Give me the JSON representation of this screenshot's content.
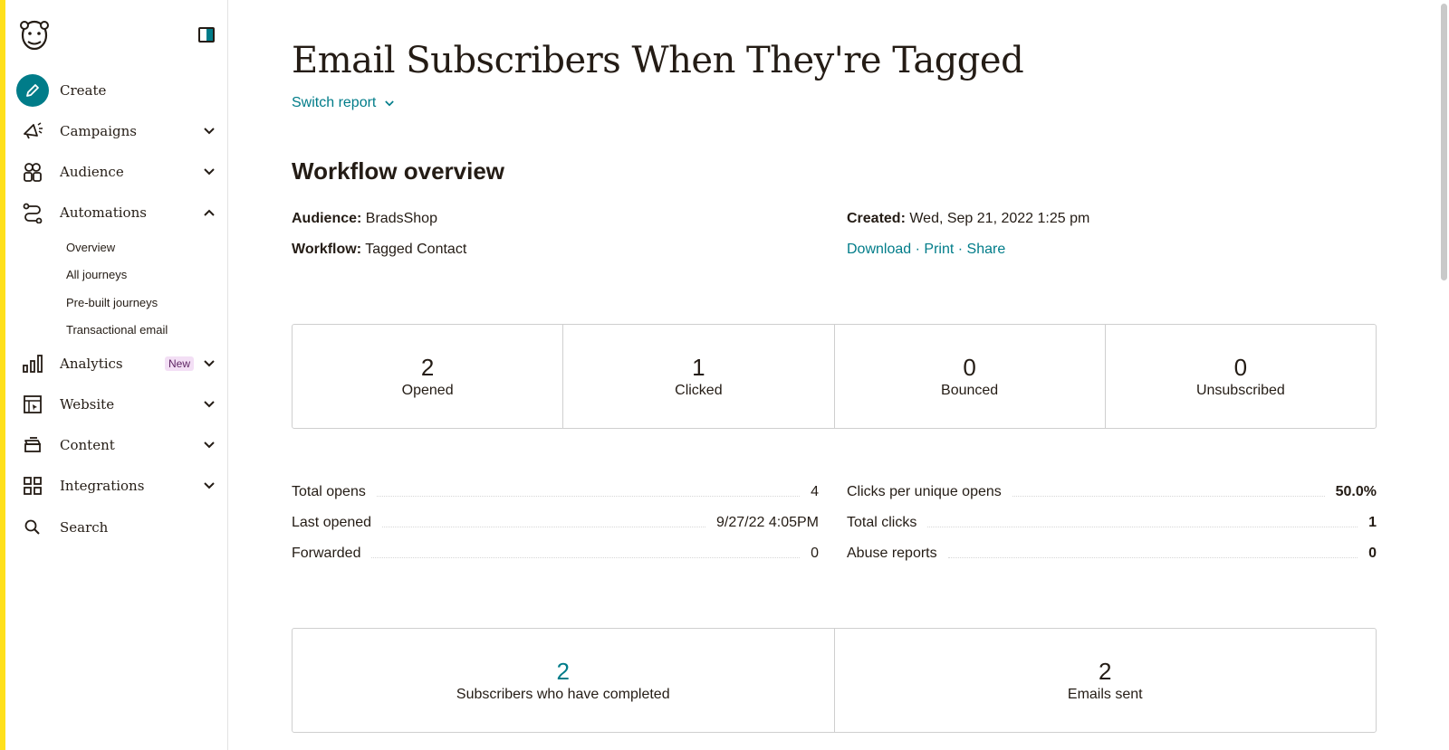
{
  "colors": {
    "accent": "#007c89",
    "brand_yellow": "#ffe01b",
    "text": "#241c15",
    "new_badge_bg": "#f3dff5"
  },
  "sidebar": {
    "logo_icon": "mailchimp-freddie-logo",
    "collapse_icon": "sidebar-toggle-icon",
    "items": [
      {
        "label": "Create",
        "icon": "pencil-icon"
      },
      {
        "label": "Campaigns",
        "icon": "megaphone-icon"
      },
      {
        "label": "Audience",
        "icon": "audience-icon"
      },
      {
        "label": "Automations",
        "icon": "automation-icon"
      },
      {
        "label": "Analytics",
        "icon": "bar-chart-icon",
        "badge": "New"
      },
      {
        "label": "Website",
        "icon": "website-icon"
      },
      {
        "label": "Content",
        "icon": "content-icon"
      },
      {
        "label": "Integrations",
        "icon": "grid-icon"
      },
      {
        "label": "Search",
        "icon": "search-icon"
      }
    ],
    "automations_sub": [
      "Overview",
      "All journeys",
      "Pre-built journeys",
      "Transactional email"
    ]
  },
  "main": {
    "title": "Email Subscribers When They're Tagged",
    "switch_report": "Switch report",
    "section_title": "Workflow overview",
    "audience_label": "Audience:",
    "audience_value": "BradsShop",
    "workflow_label": "Workflow:",
    "workflow_value": "Tagged Contact",
    "created_label": "Created:",
    "created_value": "Wed, Sep 21, 2022 1:25 pm",
    "actions": [
      "Download",
      "Print",
      "Share"
    ],
    "action_separator": "·",
    "stats": [
      {
        "value": "2",
        "label": "Opened"
      },
      {
        "value": "1",
        "label": "Clicked"
      },
      {
        "value": "0",
        "label": "Bounced"
      },
      {
        "value": "0",
        "label": "Unsubscribed"
      }
    ],
    "details_left": [
      {
        "label": "Total opens",
        "value": "4"
      },
      {
        "label": "Last opened",
        "value": "9/27/22 4:05PM"
      },
      {
        "label": "Forwarded",
        "value": "0"
      }
    ],
    "details_right": [
      {
        "label": "Clicks per unique opens",
        "value": "50.0%"
      },
      {
        "label": "Total clicks",
        "value": "1"
      },
      {
        "label": "Abuse reports",
        "value": "0"
      }
    ],
    "stats2": [
      {
        "value": "2",
        "label": "Subscribers who have completed"
      },
      {
        "value": "2",
        "label": "Emails sent"
      }
    ]
  }
}
